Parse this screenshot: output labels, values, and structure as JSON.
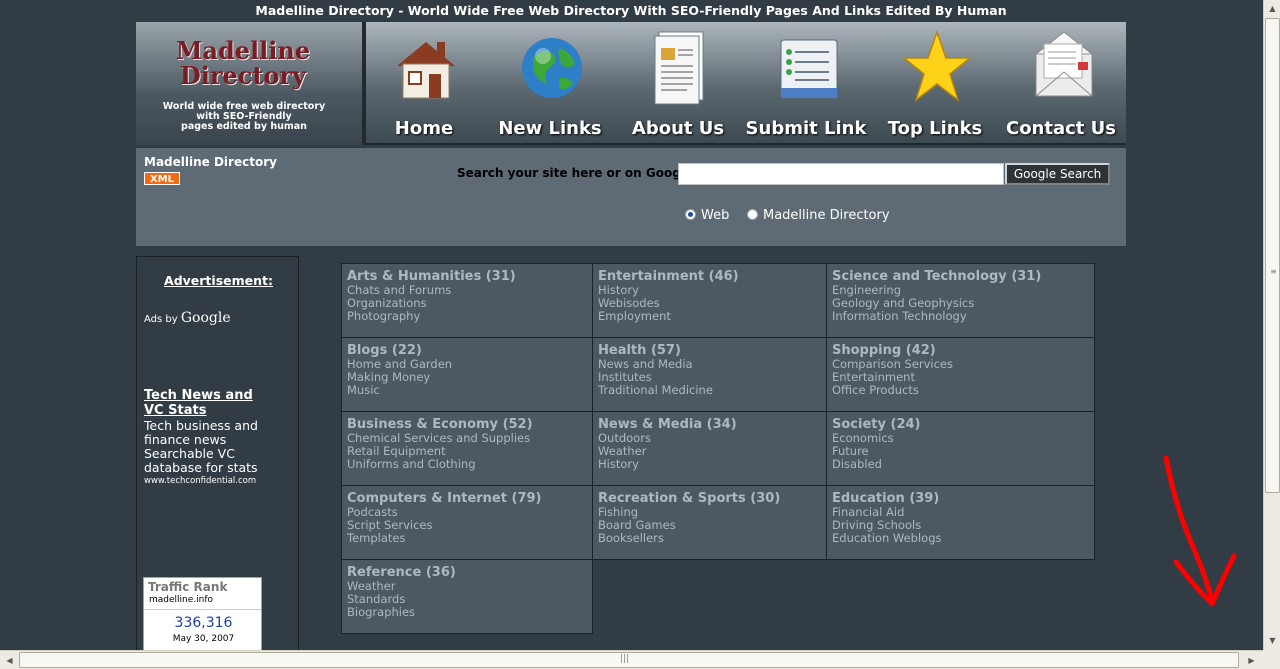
{
  "page_title": "Madelline Directory - World Wide Free Web Directory With SEO-Friendly Pages And Links Edited By Human",
  "logo": {
    "title_line1": "Madelline",
    "title_line2": "Directory",
    "subtitle_line1": "World wide free web directory",
    "subtitle_line2": "with SEO-Friendly",
    "subtitle_line3": "pages edited by human"
  },
  "nav": [
    {
      "label": "Home",
      "icon": "house-icon"
    },
    {
      "label": "New Links",
      "icon": "globe-icon"
    },
    {
      "label": "About Us",
      "icon": "document-icon"
    },
    {
      "label": "Submit Link",
      "icon": "checklist-icon"
    },
    {
      "label": "Top Links",
      "icon": "star-icon"
    },
    {
      "label": "Contact Us",
      "icon": "envelope-icon"
    }
  ],
  "search": {
    "site_name": "Madelline Directory",
    "xml_badge": "XML",
    "label": "Search your site here or on Google:",
    "input_value": "",
    "button_label": "Google Search",
    "radio_web": "Web",
    "radio_site": "Madelline Directory",
    "selected": "Web"
  },
  "sidebar": {
    "ad_title": "Advertisement:",
    "ads_by_prefix": "Ads by",
    "ads_by_brand": "Google",
    "ad_link": "Tech News and VC Stats",
    "ad_text": "Tech business and finance news Searchable VC database for stats",
    "ad_url": "www.techconfidential.com",
    "traffic": {
      "title": "Traffic Rank",
      "site": "madelline.info",
      "value": "336,316",
      "date": "May 30, 2007"
    }
  },
  "categories": [
    {
      "name": "Arts & Humanities",
      "count": "(31)",
      "subs": [
        "Chats and Forums",
        "Organizations",
        "Photography"
      ]
    },
    {
      "name": "Entertainment",
      "count": "(46)",
      "subs": [
        "History",
        "Webisodes",
        "Employment"
      ]
    },
    {
      "name": "Science and Technology",
      "count": "(31)",
      "subs": [
        "Engineering",
        "Geology and Geophysics",
        "Information Technology"
      ]
    },
    {
      "name": "Blogs",
      "count": "(22)",
      "subs": [
        "Home and Garden",
        "Making Money",
        "Music"
      ]
    },
    {
      "name": "Health",
      "count": "(57)",
      "subs": [
        "News and Media",
        "Institutes",
        "Traditional Medicine"
      ]
    },
    {
      "name": "Shopping",
      "count": "(42)",
      "subs": [
        "Comparison Services",
        "Entertainment",
        "Office Products"
      ]
    },
    {
      "name": "Business & Economy",
      "count": "(52)",
      "subs": [
        "Chemical Services and Supplies",
        "Retail Equipment",
        "Uniforms and Clothing"
      ]
    },
    {
      "name": "News & Media",
      "count": "(34)",
      "subs": [
        "Outdoors",
        "Weather",
        "History"
      ]
    },
    {
      "name": "Society",
      "count": "(24)",
      "subs": [
        "Economics",
        "Future",
        "Disabled"
      ]
    },
    {
      "name": "Computers & Internet",
      "count": "(79)",
      "subs": [
        "Podcasts",
        "Script Services",
        "Templates"
      ]
    },
    {
      "name": "Recreation & Sports",
      "count": "(30)",
      "subs": [
        "Fishing",
        "Board Games",
        "Booksellers"
      ]
    },
    {
      "name": "Education",
      "count": "(39)",
      "subs": [
        "Financial Aid",
        "Driving Schools",
        "Education Weblogs"
      ]
    },
    {
      "name": "Reference",
      "count": "(36)",
      "subs": [
        "Weather",
        "Standards",
        "Biographies"
      ]
    }
  ],
  "colors": {
    "background": "#323c44",
    "cell": "#4d5962",
    "xml_badge": "#f36a13",
    "annotation_arrow": "#ff0000"
  }
}
